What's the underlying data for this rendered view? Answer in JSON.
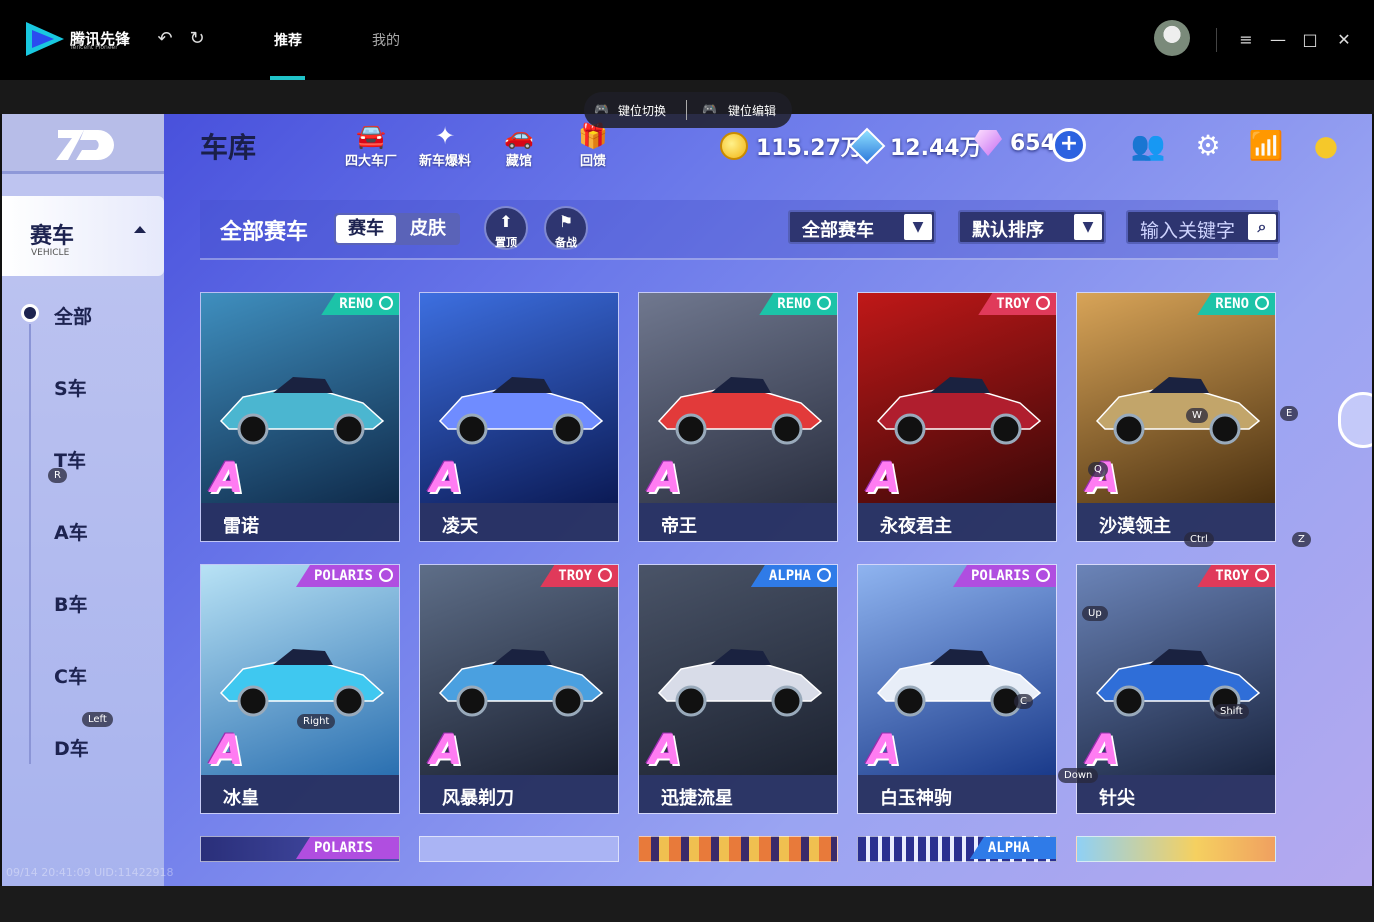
{
  "app": {
    "logo_text": "腾讯先锋",
    "logo_sub": "Tencent Pioneer",
    "tabs": [
      {
        "label": "推荐",
        "active": true
      },
      {
        "label": "我的",
        "active": false
      }
    ],
    "icons": {
      "back": "undo-icon",
      "refresh": "refresh-icon",
      "menu": "menu-icon",
      "minimize": "minimize-icon",
      "maximize": "maximize-icon",
      "close": "close-icon"
    },
    "accent": "#20c3c9"
  },
  "overlay": {
    "switch_label": "键位切换",
    "edit_label": "键位编辑"
  },
  "game": {
    "title": "车库",
    "top_icons": [
      {
        "label": "四大车厂",
        "icon": "car-factory-icon"
      },
      {
        "label": "新车爆料",
        "icon": "new-car-icon"
      },
      {
        "label": "藏馆",
        "icon": "museum-icon"
      },
      {
        "label": "回馈",
        "icon": "gift-icon"
      }
    ],
    "currency": {
      "coins": "115.27万",
      "coupons": "12.44万",
      "diamonds": "654"
    },
    "sidebar": {
      "category": "赛车",
      "category_sub": "VEHICLE",
      "items": [
        "全部",
        "S车",
        "T车",
        "A车",
        "B车",
        "C车",
        "D车"
      ]
    },
    "filter": {
      "title": "全部赛车",
      "seg_a": "赛车",
      "seg_b": "皮肤",
      "pin_label": "置顶",
      "backup_label": "备战",
      "dropdown_type": "全部赛车",
      "dropdown_sort": "默认排序",
      "search_placeholder": "输入关键字"
    },
    "cars": [
      {
        "name": "雷诺",
        "grade": "A",
        "brand": "RENO",
        "brand_color": "#1cc3a8",
        "bg": [
          "#0f2a4a",
          "#3f8fbf"
        ],
        "body": "#4bb6d0"
      },
      {
        "name": "凌天",
        "grade": "A",
        "brand": "",
        "brand_color": "",
        "bg": [
          "#0b1a55",
          "#3d6fe0"
        ],
        "body": "#6f8cff"
      },
      {
        "name": "帝王",
        "grade": "A",
        "brand": "RENO",
        "brand_color": "#1cc3a8",
        "bg": [
          "#2a2f40",
          "#70788f"
        ],
        "body": "#e23a3a"
      },
      {
        "name": "永夜君主",
        "grade": "A",
        "brand": "TROY",
        "brand_color": "#e03a5a",
        "bg": [
          "#3a0808",
          "#c01818"
        ],
        "body": "#b01e2e"
      },
      {
        "name": "沙漠领主",
        "grade": "A",
        "brand": "RENO",
        "brand_color": "#1cc3a8",
        "bg": [
          "#4a3010",
          "#d8a458"
        ],
        "body": "#c2a56a"
      },
      {
        "name": "冰皇",
        "grade": "A",
        "brand": "POLARIS",
        "brand_color": "#b04ee0",
        "bg": [
          "#2a6fb0",
          "#b8e2f5"
        ],
        "body": "#3fc8f0"
      },
      {
        "name": "风暴剃刀",
        "grade": "A",
        "brand": "TROY",
        "brand_color": "#e03a5a",
        "bg": [
          "#1a2030",
          "#5e6e88"
        ],
        "body": "#4aa0e0"
      },
      {
        "name": "迅捷流星",
        "grade": "A",
        "brand": "ALPHA",
        "brand_color": "#2f7be8",
        "bg": [
          "#1c2230",
          "#4a5468"
        ],
        "body": "#d8dce8"
      },
      {
        "name": "白玉神驹",
        "grade": "A",
        "brand": "POLARIS",
        "brand_color": "#b04ee0",
        "bg": [
          "#1a3a8a",
          "#8fb4f0"
        ],
        "body": "#e8eef8"
      },
      {
        "name": "针尖",
        "grade": "A",
        "brand": "TROY",
        "brand_color": "#e03a5a",
        "bg": [
          "#1a2540",
          "#6b84b8"
        ],
        "body": "#2f6ed8"
      }
    ],
    "partial_row": [
      {
        "brand": "POLARIS",
        "brand_color": "#b04ee0"
      },
      {
        "brand": "",
        "brand_color": ""
      },
      {
        "brand": "",
        "brand_color": ""
      },
      {
        "brand": "ALPHA",
        "brand_color": "#2f7be8"
      },
      {
        "brand": "",
        "brand_color": ""
      }
    ],
    "key_hints": [
      "R",
      "Left",
      "Right",
      "W",
      "E",
      "Q",
      "Ctrl",
      "Z",
      "Up",
      "C",
      "Shift",
      "Down"
    ],
    "watermark": "09/14 20:41:09 UID:11422918"
  }
}
